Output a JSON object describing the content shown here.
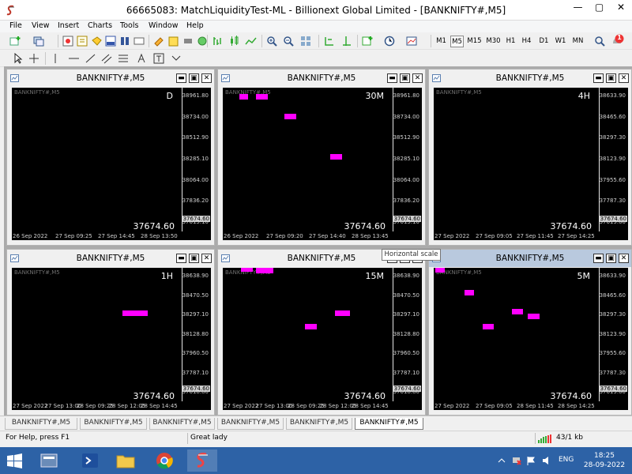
{
  "window": {
    "title": "66665083: MatchLiquidityTest-ML - Billionext Global Limited - [BANKNIFTY#,M5]",
    "min_btn": "—",
    "max_btn": "▢",
    "close_btn": "✕"
  },
  "menu": [
    "File",
    "View",
    "Insert",
    "Charts",
    "Tools",
    "Window",
    "Help"
  ],
  "timeframes": [
    {
      "label": "M1",
      "active": false
    },
    {
      "label": "M5",
      "active": true
    },
    {
      "label": "M15",
      "active": false
    },
    {
      "label": "M30",
      "active": false
    },
    {
      "label": "H1",
      "active": false
    },
    {
      "label": "H4",
      "active": false
    },
    {
      "label": "D1",
      "active": false
    },
    {
      "label": "W1",
      "active": false
    },
    {
      "label": "MN",
      "active": false
    }
  ],
  "notification_count": "1",
  "chart_buttons": {
    "minimize": "▬",
    "restore": "▣",
    "close": "✕"
  },
  "charts": [
    {
      "title": "BANKNIFTY#,M5",
      "symbol": "BANKNIFTY#,M5",
      "timeframe_label": "D",
      "price": "37674.60",
      "current_tick": "37674.60",
      "active": false,
      "ticks": [
        "38961.80",
        "38734.00",
        "38512.90",
        "38285.10",
        "38064.00",
        "37836.20",
        "37615.10"
      ],
      "dates": [
        "26 Sep 2022",
        "27 Sep 09:25",
        "27 Sep 14:45",
        "28 Sep 13:50"
      ],
      "bars": []
    },
    {
      "title": "BANKNIFTY#,M5",
      "symbol": "BANKNIFTY#,M5",
      "timeframe_label": "30M",
      "price": "37674.60",
      "current_tick": "37674.60",
      "active": false,
      "ticks": [
        "38961.80",
        "38734.00",
        "38512.90",
        "38285.10",
        "38064.00",
        "37836.20",
        "37615.10"
      ],
      "dates": [
        "26 Sep 2022",
        "27 Sep 09:20",
        "27 Sep 14:40",
        "28 Sep 13:45"
      ],
      "bars": [
        [
          0.1,
          0.15,
          38950
        ],
        [
          0.2,
          0.27,
          38955
        ],
        [
          0.37,
          0.44,
          38740
        ],
        [
          0.64,
          0.71,
          38310
        ]
      ]
    },
    {
      "title": "BANKNIFTY#,M5",
      "symbol": "BANKNIFTY#,M5",
      "timeframe_label": "4H",
      "price": "37674.60",
      "current_tick": "37674.60",
      "active": false,
      "ticks": [
        "38633.90",
        "38465.60",
        "38297.30",
        "38123.90",
        "37955.60",
        "37787.30",
        "37619.00"
      ],
      "dates": [
        "27 Sep 2022",
        "27 Sep 09:05",
        "27 Sep 11:45",
        "27 Sep 14:25"
      ],
      "bars": []
    },
    {
      "title": "BANKNIFTY#,M5",
      "symbol": "BANKNIFTY#,M5",
      "timeframe_label": "1H",
      "price": "37674.60",
      "current_tick": "37674.60",
      "active": false,
      "ticks": [
        "38638.90",
        "38470.50",
        "38297.10",
        "38128.80",
        "37960.50",
        "37787.10",
        "37618.80"
      ],
      "dates": [
        "27 Sep 2022",
        "27 Sep 13:00",
        "28 Sep 09:25",
        "28 Sep 12:05",
        "28 Sep 14:45"
      ],
      "bars": [
        [
          0.66,
          0.81,
          38310
        ]
      ]
    },
    {
      "title": "BANKNIFTY#,M5",
      "symbol": "BANKNIFTY#,M5",
      "timeframe_label": "15M",
      "price": "37674.60",
      "current_tick": "37674.60",
      "active": false,
      "ticks": [
        "38638.90",
        "38470.50",
        "38297.10",
        "38128.80",
        "37960.50",
        "37787.10",
        "37618.80"
      ],
      "dates": [
        "27 Sep 2022",
        "27 Sep 13:00",
        "28 Sep 09:25",
        "28 Sep 12:05",
        "28 Sep 14:45"
      ],
      "bars": [
        [
          0.11,
          0.18,
          38700
        ],
        [
          0.2,
          0.3,
          38690
        ],
        [
          0.49,
          0.56,
          38195
        ],
        [
          0.67,
          0.76,
          38315
        ]
      ]
    },
    {
      "title": "BANKNIFTY#,M5",
      "symbol": "BANKNIFTY#,M5",
      "timeframe_label": "5M",
      "price": "37674.60",
      "current_tick": "37674.60",
      "active": true,
      "ticks": [
        "38633.90",
        "38465.60",
        "38297.30",
        "38123.90",
        "37955.60",
        "37787.30",
        "37619.00"
      ],
      "dates": [
        "27 Sep 2022",
        "27 Sep 09:05",
        "28 Sep 11:45",
        "28 Sep 14:25"
      ],
      "bars": [
        [
          0.01,
          0.07,
          38690
        ],
        [
          0.19,
          0.25,
          38490
        ],
        [
          0.3,
          0.37,
          38195
        ],
        [
          0.48,
          0.55,
          38320
        ],
        [
          0.58,
          0.65,
          38280
        ]
      ]
    }
  ],
  "tooltip": "Horizontal scale",
  "tabs": [
    {
      "label": "BANKNIFTY#,M5",
      "active": false
    },
    {
      "label": "BANKNIFTY#,M5",
      "active": false
    },
    {
      "label": "BANKNIFTY#,M5",
      "active": false
    },
    {
      "label": "BANKNIFTY#,M5",
      "active": false
    },
    {
      "label": "BANKNIFTY#,M5",
      "active": false
    },
    {
      "label": "BANKNIFTY#,M5",
      "active": true
    }
  ],
  "status": {
    "help": "For Help, press F1",
    "profile": "Great lady",
    "traffic": "43/1 kb"
  },
  "taskbar": {
    "lang": "ENG",
    "time": "18:25",
    "date": "28-09-2022"
  }
}
